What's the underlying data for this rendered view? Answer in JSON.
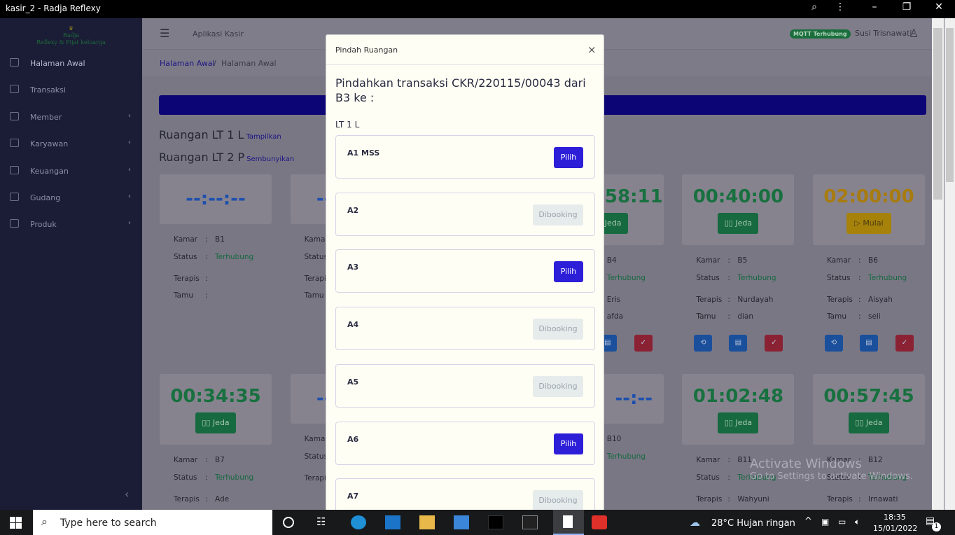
{
  "window": {
    "title": "kasir_2 - Radja Reflexy"
  },
  "logo": {
    "line1": "Radja",
    "line2": "Reflexy & Pijat keluarga"
  },
  "sidebar": {
    "items": [
      {
        "label": "Halaman Awal",
        "icon": "dashboard-icon"
      },
      {
        "label": "Transaksi",
        "icon": "receipt-icon"
      },
      {
        "label": "Member",
        "icon": "book-icon",
        "chevron": "‹"
      },
      {
        "label": "Karyawan",
        "icon": "user-icon",
        "chevron": "‹"
      },
      {
        "label": "Keuangan",
        "icon": "money-icon",
        "chevron": "‹"
      },
      {
        "label": "Gudang",
        "icon": "warehouse-icon",
        "chevron": "‹"
      },
      {
        "label": "Produk",
        "icon": "tag-icon",
        "chevron": "‹"
      }
    ],
    "collapse": "‹"
  },
  "header": {
    "app": "Aplikasi Kasir",
    "mqtt_badge": "MQTT Terhubung",
    "user": "Susi Trisnawati"
  },
  "breadcrumb": {
    "link": "Halaman Awal",
    "sep": "/",
    "current": "Halaman Awal"
  },
  "sections": [
    {
      "title": "Ruangan LT 1 L",
      "toggle": "Tampilkan"
    },
    {
      "title": "Ruangan LT 2 P",
      "toggle": "Sembunyikan"
    }
  ],
  "labels": {
    "kamar": "Kamar",
    "status": "Status",
    "terapis": "Terapis",
    "tamu": "Tamu",
    "colon": ":",
    "jeda": "▯▯ Jeda",
    "mulai": "▷ Mulai"
  },
  "cards": [
    {
      "kamar": "B1",
      "status": "Terhubung",
      "terapis": "",
      "tamu": "",
      "timer": "--:--:--",
      "state": "idle"
    },
    {
      "kamar": "",
      "status": "",
      "terapis": "",
      "tamu": "",
      "timer": "--:--:--",
      "state": "idle"
    },
    {
      "kamar": "",
      "status": "",
      "terapis": "",
      "tamu": "",
      "timer": "",
      "state": "hidden"
    },
    {
      "kamar": "B4",
      "status": "Terhubung",
      "terapis": "Eris",
      "tamu": "afda",
      "timer": "58:11",
      "state": "running"
    },
    {
      "kamar": "B5",
      "status": "Terhubung",
      "terapis": "Nurdayah",
      "tamu": "dian",
      "timer": "00:40:00",
      "state": "running"
    },
    {
      "kamar": "B6",
      "status": "Terhubung",
      "terapis": "Aisyah",
      "tamu": "seli",
      "timer": "02:00:00",
      "state": "ready"
    },
    {
      "kamar": "B7",
      "status": "Terhubung",
      "terapis": "Ade",
      "tamu": "",
      "timer": "00:34:35",
      "state": "running"
    },
    {
      "kamar": "",
      "status": "",
      "terapis": "",
      "tamu": "",
      "timer": "--:--:--",
      "state": "idle"
    },
    {
      "kamar": "",
      "status": "",
      "terapis": "",
      "tamu": "",
      "timer": "",
      "state": "hidden"
    },
    {
      "kamar": "B10",
      "status": "Terhubung",
      "terapis": "",
      "tamu": "",
      "timer": "--:--",
      "state": "idle"
    },
    {
      "kamar": "B11",
      "status": "Terhubung",
      "terapis": "Wahyuni",
      "tamu": "",
      "timer": "01:02:48",
      "state": "running"
    },
    {
      "kamar": "B12",
      "status": "Terhubung",
      "terapis": "Irnawati",
      "tamu": "",
      "timer": "00:57:45",
      "state": "running"
    }
  ],
  "modal": {
    "title": "Pindah Ruangan",
    "close": "×",
    "heading": "Pindahkan transaksi CKR/220115/00043 dari B3 ke :",
    "floor": "LT 1 L",
    "rooms": [
      {
        "name": "A1 MSS",
        "action": "Pilih"
      },
      {
        "name": "A2",
        "action": "Dibooking"
      },
      {
        "name": "A3",
        "action": "Pilih"
      },
      {
        "name": "A4",
        "action": "Dibooking"
      },
      {
        "name": "A5",
        "action": "Dibooking"
      },
      {
        "name": "A6",
        "action": "Pilih"
      },
      {
        "name": "A7",
        "action": "Dibooking"
      }
    ]
  },
  "watermark": {
    "line1": "Activate Windows",
    "line2": "Go to Settings to activate Windows."
  },
  "taskbar": {
    "search_placeholder": "Type here to search",
    "weather": "28°C  Hujan ringan",
    "time": "18:35",
    "date": "15/01/2022",
    "notif_count": "1"
  },
  "colors": {
    "green": "#18703f",
    "blue_timer": "#1c4fae",
    "amber": "#a87b0e",
    "primary": "#2d1fd8",
    "banner": "#0c0576"
  }
}
